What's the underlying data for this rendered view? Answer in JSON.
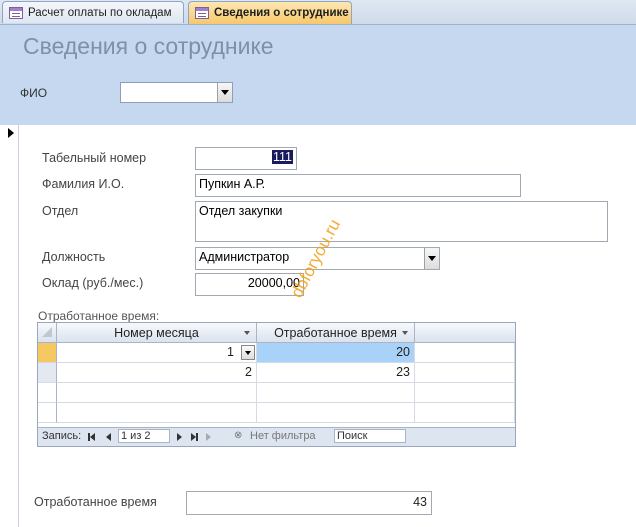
{
  "tabs": [
    {
      "label": "Расчет оплаты по окладам",
      "active": false
    },
    {
      "label": "Сведения о сотруднике",
      "active": true
    }
  ],
  "header": {
    "title": "Сведения о сотруднике",
    "fio_label": "ФИО",
    "fio_value": ""
  },
  "fields": {
    "tab_number": {
      "label": "Табельный номер",
      "value": "111"
    },
    "name": {
      "label": "Фамилия И.О.",
      "value": "Пупкин А.Р."
    },
    "department": {
      "label": "Отдел",
      "value": "Отдел закупки"
    },
    "position": {
      "label": "Должность",
      "value": "Администратор"
    },
    "salary": {
      "label": "Оклад (руб./мес.)",
      "value": "20000,00"
    }
  },
  "subform": {
    "label": "Отработанное время:",
    "columns": [
      "Номер месяца",
      "Отработанное время"
    ],
    "rows": [
      {
        "month": "1",
        "hours": "20"
      },
      {
        "month": "2",
        "hours": "23"
      }
    ],
    "nav": {
      "record_label": "Запись:",
      "position": "1 из 2",
      "filter_label": "Нет фильтра",
      "search_label": "Поиск"
    }
  },
  "total": {
    "label": "Отработанное время",
    "value": "43"
  },
  "watermark": "dbforyou.ru",
  "colors": {
    "header_bg": "#c6d8ef",
    "active_tab": "#f8c86a",
    "selection": "#a8d2f8"
  }
}
